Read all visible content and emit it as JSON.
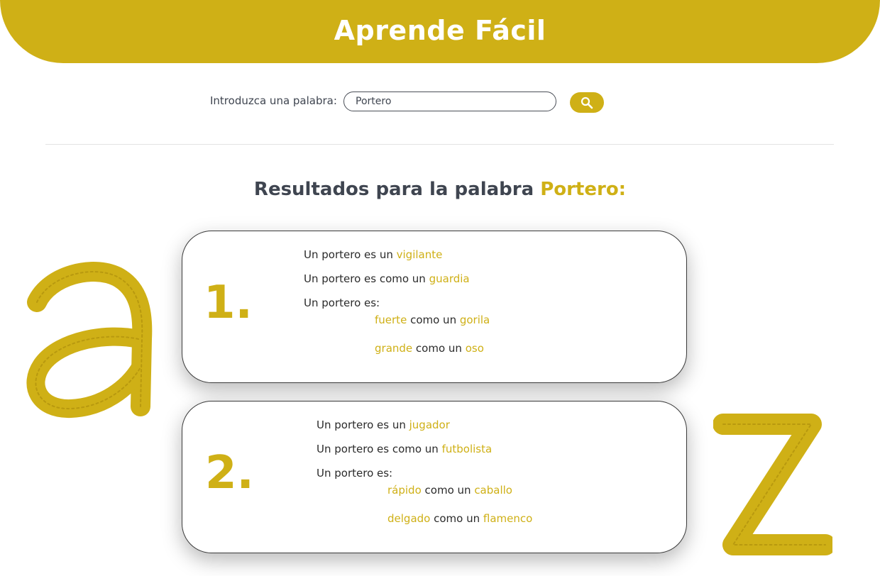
{
  "header": {
    "title": "Aprende Fácil"
  },
  "search": {
    "label": "Introduzca una palabra:",
    "value": "Portero",
    "button_icon": "search-icon"
  },
  "results": {
    "title_prefix": "Resultados para la palabra",
    "title_word": "Portero:"
  },
  "cards": [
    {
      "number": "1.",
      "line1": {
        "text": "Un portero es un",
        "word": "vigilante"
      },
      "line2": {
        "text": "Un portero es como un",
        "word": "guardia"
      },
      "line3": {
        "text": "Un portero es:"
      },
      "comp1": {
        "adj": "fuerte",
        "mid": "como un",
        "noun": "gorila"
      },
      "comp2": {
        "adj": "grande",
        "mid": "como un",
        "noun": "oso"
      }
    },
    {
      "number": "2.",
      "line1": {
        "text": "Un portero es un",
        "word": "jugador"
      },
      "line2": {
        "text": "Un portero es como un",
        "word": "futbolista"
      },
      "line3": {
        "text": "Un portero es:"
      },
      "comp1": {
        "adj": "rápido",
        "mid": "como un",
        "noun": "caballo"
      },
      "comp2": {
        "adj": "delgado",
        "mid": "como un",
        "noun": "flamenco"
      }
    }
  ],
  "decorations": {
    "left_letter": "letter-a-sketch",
    "right_letter": "letter-z-sketch"
  },
  "colors": {
    "accent": "#cfb016",
    "text": "#3f4550"
  }
}
